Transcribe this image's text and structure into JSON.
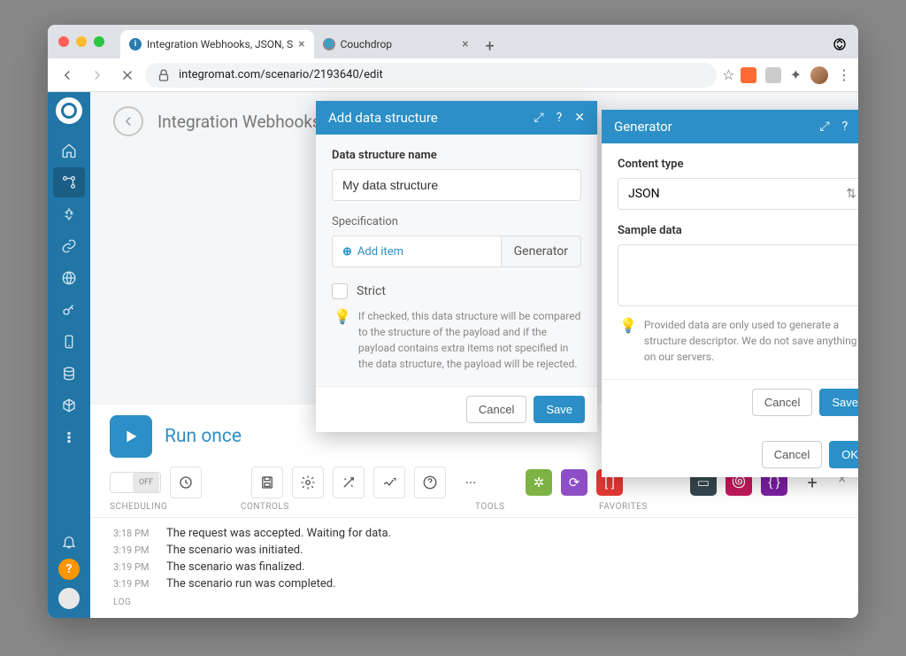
{
  "browser": {
    "tabs": [
      {
        "title": "Integration Webhooks, JSON, S",
        "active": true
      },
      {
        "title": "Couchdrop",
        "active": false
      }
    ],
    "url": "integromat.com/scenario/2193640/edit"
  },
  "page": {
    "title": "Integration Webhooks"
  },
  "run": {
    "label": "Run once"
  },
  "toolbar": {
    "toggle": "OFF",
    "labels": {
      "scheduling": "SCHEDULING",
      "controls": "CONTROLS",
      "tools": "TOOLS",
      "favorites": "FAVORITES"
    }
  },
  "log": {
    "label": "LOG",
    "entries": [
      {
        "time": "3:18 PM",
        "msg": "The request was accepted. Waiting for data."
      },
      {
        "time": "3:19 PM",
        "msg": "The scenario was initiated."
      },
      {
        "time": "3:19 PM",
        "msg": "The scenario was finalized."
      },
      {
        "time": "3:19 PM",
        "msg": "The scenario run was completed."
      }
    ]
  },
  "modal1": {
    "title": "Add data structure",
    "name_label": "Data structure name",
    "name_value": "My data structure",
    "spec_label": "Specification",
    "add_item": "Add item",
    "generator": "Generator",
    "strict": "Strict",
    "strict_hint": "If checked, this data structure will be compared to the structure of the payload and if the payload contains extra items not specified in the data structure, the payload will be rejected.",
    "cancel": "Cancel",
    "save": "Save"
  },
  "modal2": {
    "title": "Generator",
    "content_type_label": "Content type",
    "content_type_value": "JSON",
    "sample_label": "Sample data",
    "hint": "Provided data are only used to generate a structure descriptor. We do not save anything on our servers.",
    "cancel": "Cancel",
    "save": "Save",
    "outer_cancel": "Cancel",
    "outer_ok": "OK"
  }
}
